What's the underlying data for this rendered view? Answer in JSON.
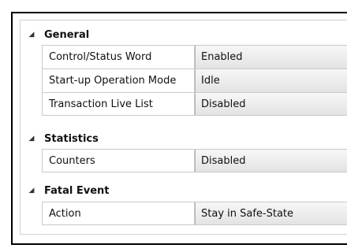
{
  "groups": [
    {
      "title": "General",
      "toggle_icon": "triangle-expanded",
      "properties": [
        {
          "name": "Control/Status Word",
          "value": "Enabled"
        },
        {
          "name": "Start-up Operation Mode",
          "value": "Idle"
        },
        {
          "name": "Transaction Live List",
          "value": "Disabled"
        }
      ]
    },
    {
      "title": "Statistics",
      "toggle_icon": "triangle-expanded",
      "properties": [
        {
          "name": "Counters",
          "value": "Disabled"
        }
      ]
    },
    {
      "title": "Fatal Event",
      "toggle_icon": "triangle-expanded",
      "properties": [
        {
          "name": "Action",
          "value": "Stay in Safe-State"
        }
      ]
    }
  ]
}
